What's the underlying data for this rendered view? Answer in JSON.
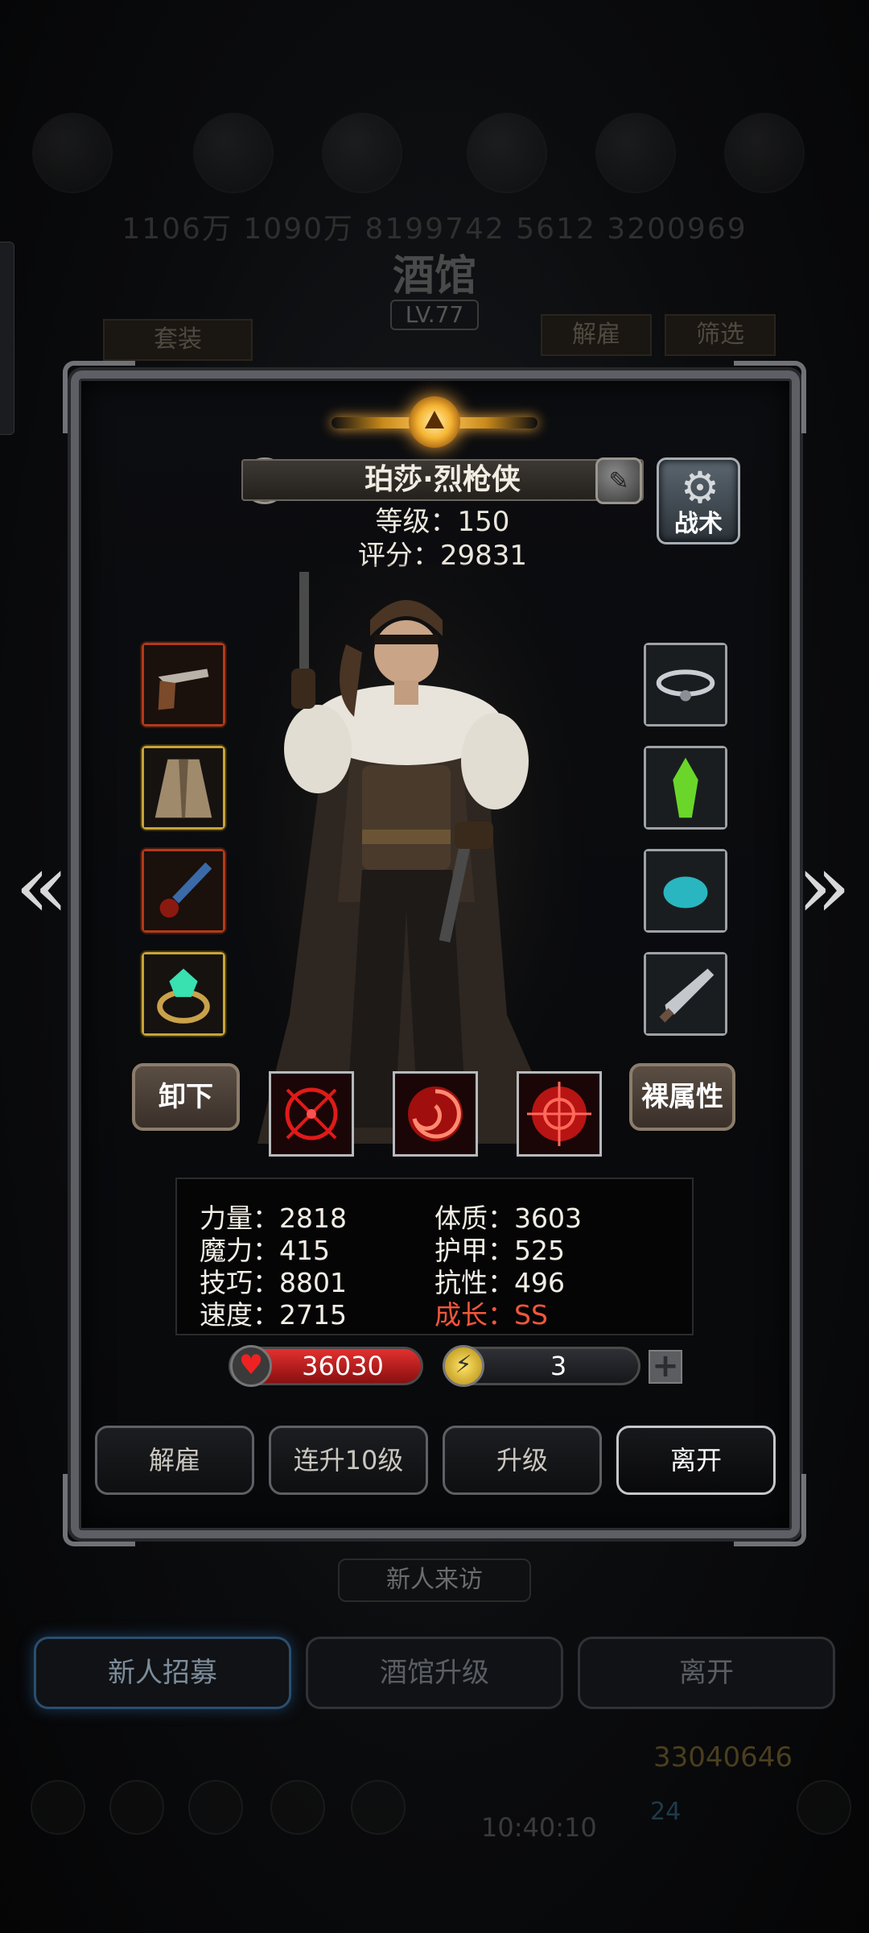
{
  "background": {
    "resource_values": "1106万   1090万   8199742   5612   3200969",
    "title": "酒馆",
    "level": "LV.77",
    "set_btn": "套装",
    "dismiss_btn": "解雇",
    "filter_btn": "筛选",
    "visitor_label": "新人来访",
    "tabs": [
      "新人招募",
      "酒馆升级",
      "离开"
    ],
    "gold": "33040646",
    "gems": "24",
    "time": "10:40:10"
  },
  "hero": {
    "name": "珀莎·烈枪侠",
    "level_text": "等级：150",
    "score_text": "评分：29831",
    "tactic_label": "战术"
  },
  "equipment": {
    "left": [
      {
        "icon": "flintlock-pistol-icon",
        "rarity": "red"
      },
      {
        "icon": "fur-coat-icon",
        "rarity": "gold"
      },
      {
        "icon": "blue-quill-icon",
        "rarity": "red"
      },
      {
        "icon": "emerald-ring-icon",
        "rarity": "gold"
      }
    ],
    "right": [
      {
        "icon": "silver-cloud-amulet-icon",
        "rarity": "grey"
      },
      {
        "icon": "green-crystal-icon",
        "rarity": "grey"
      },
      {
        "icon": "teal-stone-icon",
        "rarity": "grey"
      },
      {
        "icon": "dagger-icon",
        "rarity": "grey"
      }
    ]
  },
  "actions_row": {
    "unequip": "卸下",
    "base_attr": "裸属性"
  },
  "skills": [
    "crosshair-skill-icon",
    "spiral-skill-icon",
    "target-skill-icon"
  ],
  "stats": {
    "str": "力量：2818",
    "mag": "魔力：415",
    "skl": "技巧：8801",
    "spd": "速度：2715",
    "con": "体质：3603",
    "arm": "护甲：525",
    "res": "抗性：496",
    "growth": "成长：SS"
  },
  "resources": {
    "hp": "36030",
    "energy": "3",
    "plus": "+"
  },
  "buttons": [
    "解雇",
    "连升10级",
    "升级",
    "离开"
  ],
  "colors": {
    "growth": "#f3563a",
    "hp": "#d72626",
    "accent_gold": "#f6b433"
  }
}
